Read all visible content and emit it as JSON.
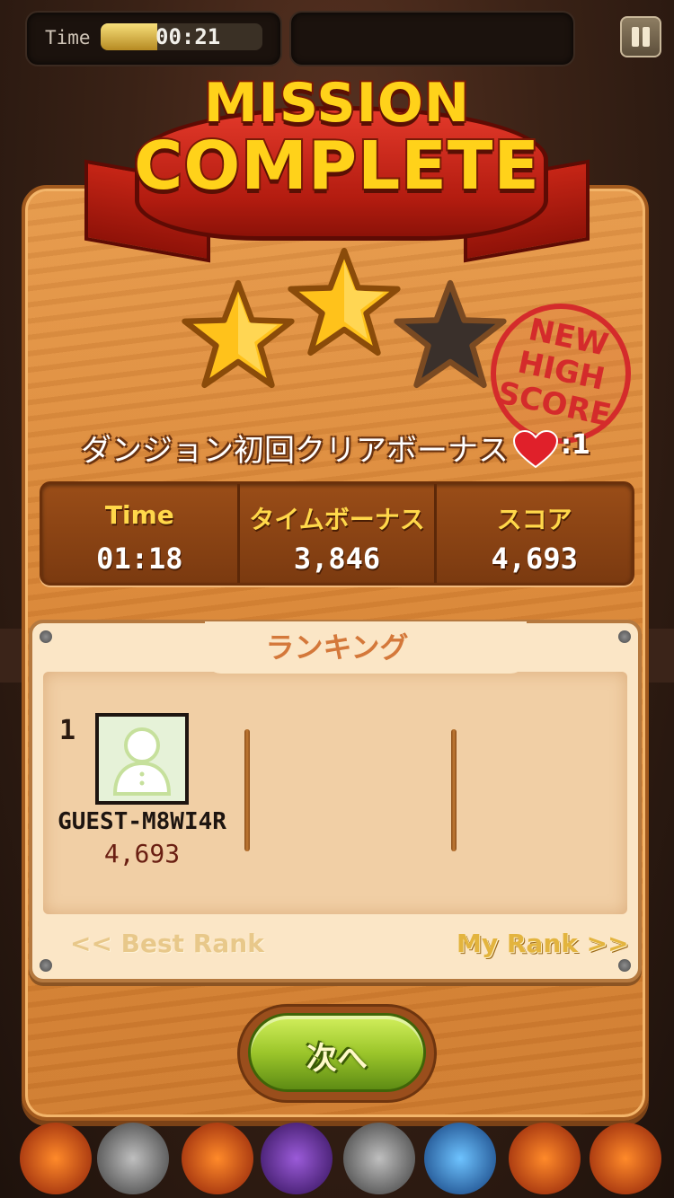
{
  "hud": {
    "time_label": "Time",
    "time_value": "00:21",
    "time_fill": 0.35,
    "pause_icon": "pause-icon"
  },
  "banner": {
    "line1": "MISSION",
    "line2": "COMPLETE"
  },
  "stars": {
    "earned": 2,
    "total": 3
  },
  "stamp": {
    "line1": "NEW",
    "line2": "HIGH",
    "line3": "SCORE"
  },
  "bonus": {
    "text": "ダンジョン初回クリアボーナス",
    "icon": "heart-icon",
    "count": ":1"
  },
  "stats": {
    "time_label": "Time",
    "time_value": "01:18",
    "time_bonus_label": "タイムボーナス",
    "time_bonus_value": "3,846",
    "score_label": "スコア",
    "score_value": "4,693"
  },
  "ranking": {
    "title": "ランキング",
    "entries": [
      {
        "rank": "1",
        "name": "GUEST-M8WI4R",
        "score": "4,693"
      }
    ],
    "best_rank": "<< Best Rank",
    "my_rank": "My Rank >>"
  },
  "next_button": {
    "label": "次へ"
  },
  "colors": {
    "banner_text": "#ffd21a",
    "ribbon": "#c62516",
    "panel": "#d98637",
    "stat_label": "#ffd84a",
    "stamp": "#d42b2b",
    "button": "#9cc62b"
  }
}
